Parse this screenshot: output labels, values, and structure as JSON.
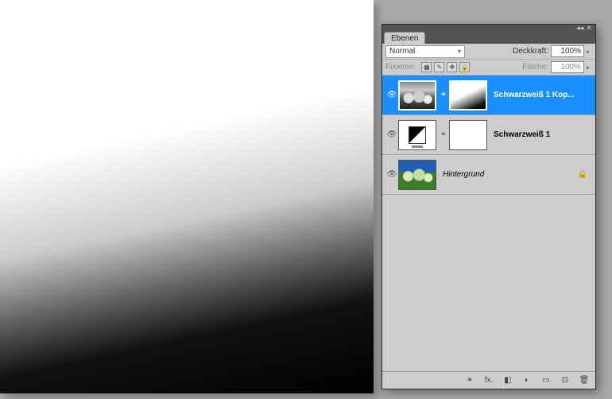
{
  "panel": {
    "tab_label": "Ebenen",
    "blend_mode": "Normal",
    "opacity_label": "Deckkraft:",
    "opacity_value": "100%",
    "lock_label": "Fixieren:",
    "fill_label": "Fläche:",
    "fill_value": "100%",
    "layers": [
      {
        "name": "Schwarzweiß 1 Kop...",
        "selected": true,
        "visible": true,
        "linked": true,
        "locked": false,
        "thumb": "dandelion-bw",
        "mask": "mask-grad"
      },
      {
        "name": "Schwarzweiß 1",
        "selected": false,
        "visible": true,
        "linked": true,
        "locked": false,
        "thumb": "adj-icon",
        "mask": "mask-white"
      },
      {
        "name": "Hintergrund",
        "selected": false,
        "visible": true,
        "linked": false,
        "locked": true,
        "name_style": "italic",
        "thumb": "dandelion-color",
        "mask": null
      }
    ],
    "footer_icons": {
      "link": "⚭",
      "fx": "fx.",
      "mask": "◧",
      "adjust": "◐",
      "group": "▭",
      "new": "⊡",
      "trash": "🗑"
    },
    "lock_icons": {
      "transparency": "▦",
      "brush": "✎",
      "move": "✥",
      "all": "🔒"
    },
    "titlebar_icons": {
      "menu": "◂◂",
      "close": "✕"
    }
  }
}
